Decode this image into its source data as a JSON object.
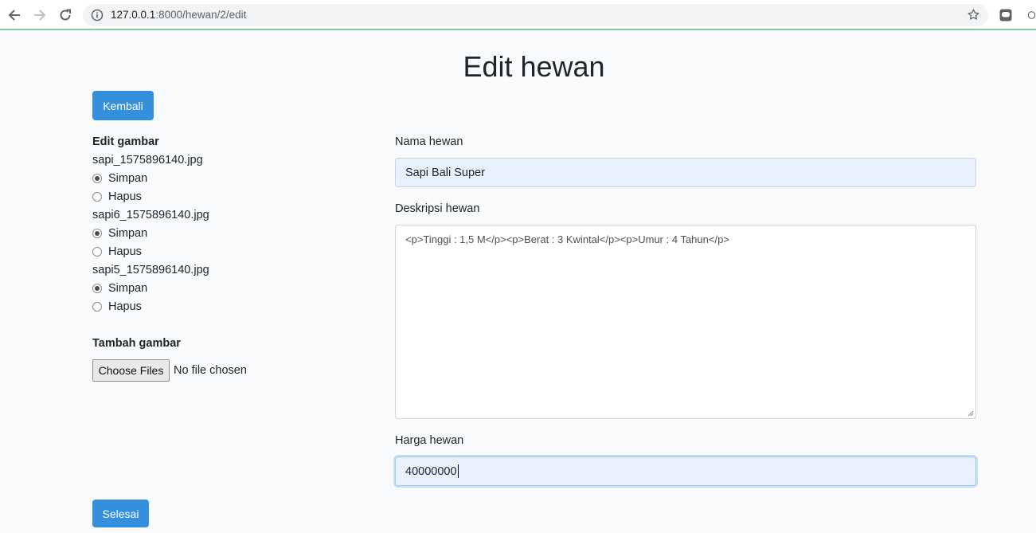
{
  "browser": {
    "url_host": "127.0.0.1",
    "url_path": ":8000/hewan/2/edit"
  },
  "page": {
    "title": "Edit hewan",
    "back_button": "Kembali",
    "submit_button": "Selesai"
  },
  "images": {
    "heading": "Edit gambar",
    "keep_label": "Simpan",
    "delete_label": "Hapus",
    "files": [
      {
        "name": "sapi_1575896140.jpg",
        "selected": "Simpan"
      },
      {
        "name": "sapi6_1575896140.jpg",
        "selected": "Simpan"
      },
      {
        "name": "sapi5_1575896140.jpg",
        "selected": "Simpan"
      }
    ]
  },
  "add_images": {
    "heading": "Tambah gambar",
    "button": "Choose Files",
    "status": "No file chosen"
  },
  "form": {
    "name_label": "Nama hewan",
    "name_value": "Sapi Bali Super",
    "desc_label": "Deskripsi hewan",
    "desc_value": "<p>Tinggi : 1,5 M</p><p>Berat : 3 Kwintal</p><p>Umur : 4 Tahun</p>",
    "price_label": "Harga hewan",
    "price_value": "40000000"
  },
  "colors": {
    "primary": "#3490dc",
    "page_bg": "#f8fafc",
    "autofill_bg": "#e8f0fe"
  }
}
